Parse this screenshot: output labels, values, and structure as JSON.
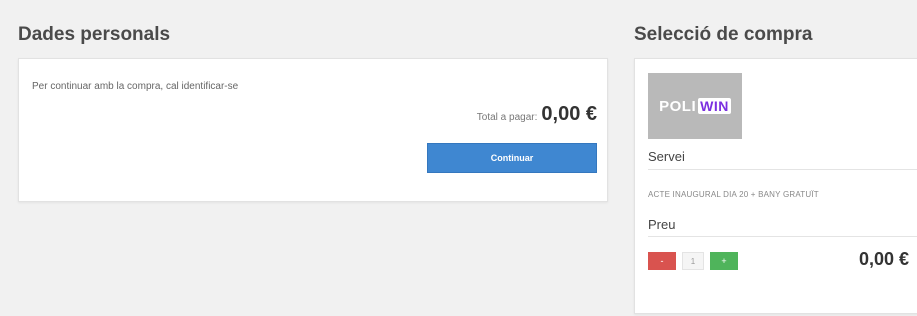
{
  "personal": {
    "title": "Dades personals",
    "message": "Per continuar amb la compra, cal identificar-se",
    "total_label": "Total a pagar:",
    "total_value": "0,00 €",
    "continue_label": "Continuar"
  },
  "purchase": {
    "title": "Selecció de compra",
    "logo_primary": "POLI",
    "logo_secondary": "WIN",
    "logo_sub": "",
    "service_label": "Servei",
    "event_name": "ACTE INAUGURAL DIA 20 + BANY GRATUÏT",
    "price_label": "Preu",
    "minus_label": "-",
    "quantity": "1",
    "plus_label": "+",
    "price_value": "0,00 €"
  },
  "colors": {
    "continue_button": "#3f87d1",
    "minus_button": "#d9534f",
    "plus_button": "#4fb45b",
    "logo_background": "#b9b9b9",
    "logo_accent": "#7b2fe0"
  }
}
